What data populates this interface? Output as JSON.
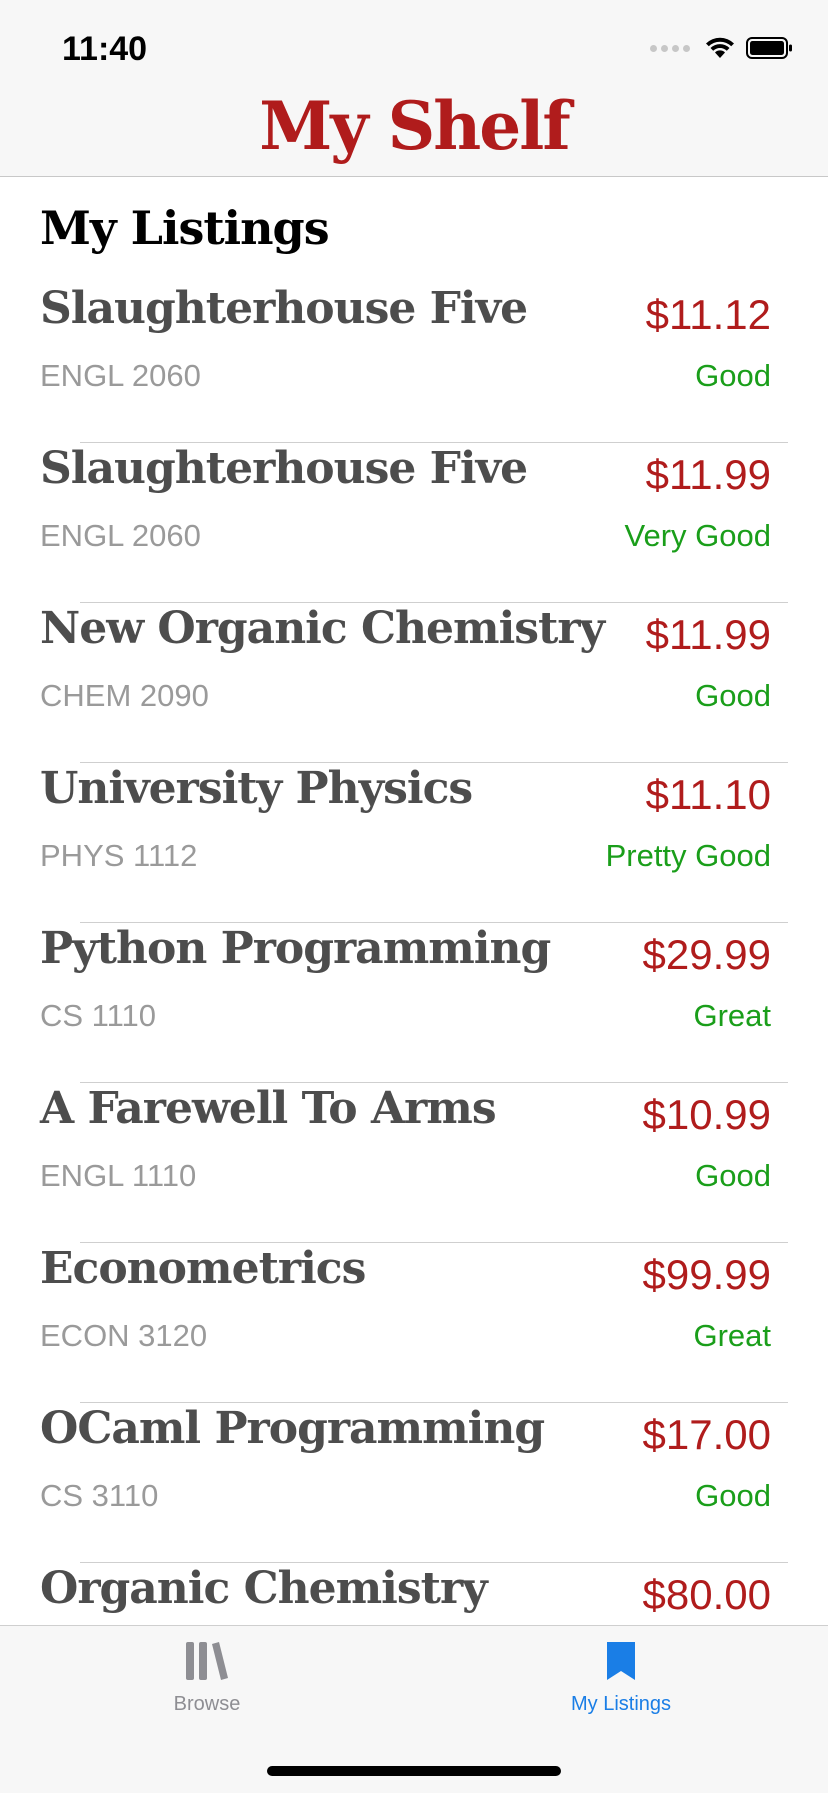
{
  "status_bar": {
    "time": "11:40"
  },
  "nav": {
    "title": "My Shelf"
  },
  "section": {
    "title": "My Listings"
  },
  "listings": [
    {
      "title": "Slaughterhouse Five",
      "course": "ENGL 2060",
      "price": "$11.12",
      "condition": "Good"
    },
    {
      "title": "Slaughterhouse Five",
      "course": "ENGL 2060",
      "price": "$11.99",
      "condition": "Very Good"
    },
    {
      "title": "New Organic Chemistry",
      "course": "CHEM 2090",
      "price": "$11.99",
      "condition": "Good"
    },
    {
      "title": "University Physics",
      "course": "PHYS 1112",
      "price": "$11.10",
      "condition": "Pretty Good"
    },
    {
      "title": "Python Programming",
      "course": "CS 1110",
      "price": "$29.99",
      "condition": "Great"
    },
    {
      "title": "A Farewell To Arms",
      "course": "ENGL 1110",
      "price": "$10.99",
      "condition": "Good"
    },
    {
      "title": "Econometrics",
      "course": "ECON 3120",
      "price": "$99.99",
      "condition": "Great"
    },
    {
      "title": "OCaml Programming",
      "course": "CS 3110",
      "price": "$17.00",
      "condition": "Good"
    },
    {
      "title": "Organic Chemistry",
      "course": "",
      "price": "$80.00",
      "condition": ""
    }
  ],
  "tab_bar": {
    "tabs": [
      {
        "label": "Browse",
        "icon": "books-icon",
        "active": false
      },
      {
        "label": "My Listings",
        "icon": "bookmark-icon",
        "active": true
      }
    ]
  },
  "colors": {
    "brand": "#b01c1c",
    "condition": "#1a9e1a",
    "active_tab": "#1a7ee6",
    "inactive_tab": "#8e8e93"
  }
}
